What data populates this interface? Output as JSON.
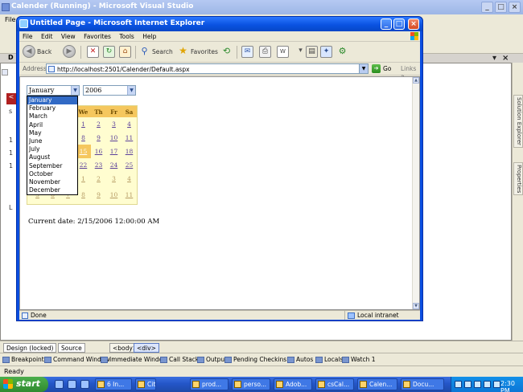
{
  "vs": {
    "title": "Calender (Running) - Microsoft Visual Studio",
    "menu_first": "File",
    "doc_tab": "D",
    "status": "Ready",
    "design_tabs": {
      "design": "Design (locked)",
      "source": "Source"
    },
    "tag_tabs": [
      "<body>",
      "<div>"
    ],
    "right_tabs": [
      "Solution Explorer",
      "Properties"
    ],
    "tool_windows": [
      "Breakpoints",
      "Command Window",
      "Immediate Window",
      "Call Stack",
      "Output",
      "Pending Checkins",
      "Autos",
      "Locals",
      "Watch 1"
    ]
  },
  "ie": {
    "title": "Untitled Page - Microsoft Internet Explorer",
    "menu": [
      "File",
      "Edit",
      "View",
      "Favorites",
      "Tools",
      "Help"
    ],
    "toolbar": {
      "back": "Back",
      "search": "Search",
      "favorites": "Favorites"
    },
    "address_label": "Address",
    "address": "http://localhost:2501/Calender/Default.aspx",
    "go": "Go",
    "links": "Links",
    "status_done": "Done",
    "status_zone": "Local intranet"
  },
  "page": {
    "month_selected": "January",
    "year_selected": "2006",
    "months": [
      "January",
      "February",
      "March",
      "April",
      "May",
      "June",
      "July",
      "August",
      "September",
      "October",
      "November",
      "December"
    ],
    "calendar": {
      "dow_visible": [
        "We",
        "Th",
        "Fr",
        "Sa"
      ],
      "rows": [
        [
          "1",
          "2",
          "3",
          "4"
        ],
        [
          "8",
          "9",
          "10",
          "11"
        ],
        [
          "15",
          "16",
          "17",
          "18"
        ],
        [
          "22",
          "23",
          "24",
          "25"
        ],
        [
          "1",
          "2",
          "3",
          "4"
        ],
        [
          "5",
          "6",
          "7",
          "8",
          "9",
          "10",
          "11"
        ]
      ],
      "selected_day": "15"
    },
    "current_date": "Current date: 2/15/2006 12:00:00 AM"
  },
  "taskbar": {
    "start": "start",
    "tasks": [
      "6 In...",
      "Citrix...",
      "prod...",
      "perso...",
      "Adob...",
      "csCal...",
      "Calen...",
      "Docu..."
    ],
    "clock": "2:30 PM"
  }
}
